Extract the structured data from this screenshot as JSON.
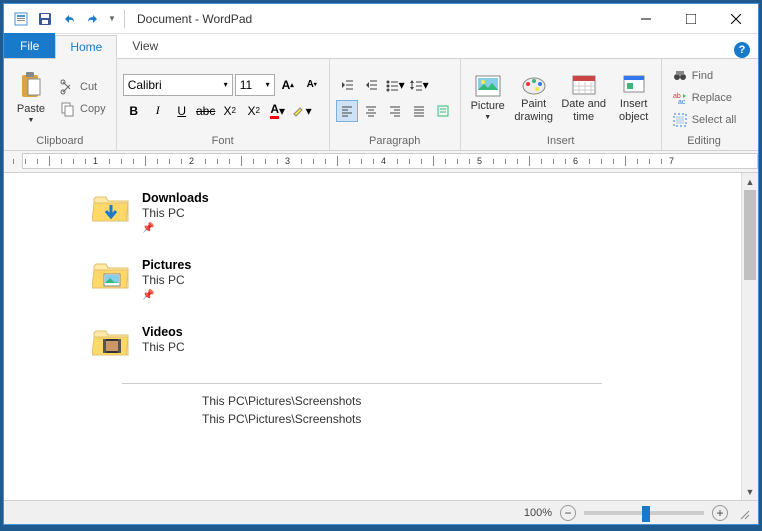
{
  "titlebar": {
    "title": "Document - WordPad"
  },
  "tabs": {
    "file": "File",
    "home": "Home",
    "view": "View"
  },
  "clipboard": {
    "label": "Clipboard",
    "paste": "Paste",
    "cut": "Cut",
    "copy": "Copy"
  },
  "font": {
    "label": "Font",
    "name": "Calibri",
    "size": "11"
  },
  "paragraph": {
    "label": "Paragraph"
  },
  "insert": {
    "label": "Insert",
    "picture": "Picture",
    "paint": "Paint drawing",
    "datetime": "Date and time",
    "object": "Insert object"
  },
  "editing": {
    "label": "Editing",
    "find": "Find",
    "replace": "Replace",
    "selectall": "Select all"
  },
  "ruler": [
    "1",
    "2",
    "3",
    "4",
    "5",
    "6",
    "7"
  ],
  "doc": {
    "items": [
      {
        "name": "Downloads",
        "loc": "This PC",
        "pinned": true,
        "type": "downloads"
      },
      {
        "name": "Pictures",
        "loc": "This PC",
        "pinned": true,
        "type": "pictures"
      },
      {
        "name": "Videos",
        "loc": "This PC",
        "pinned": false,
        "type": "videos"
      }
    ],
    "paths": [
      "This PC\\Pictures\\Screenshots",
      "This PC\\Pictures\\Screenshots"
    ]
  },
  "status": {
    "zoom": "100%"
  }
}
